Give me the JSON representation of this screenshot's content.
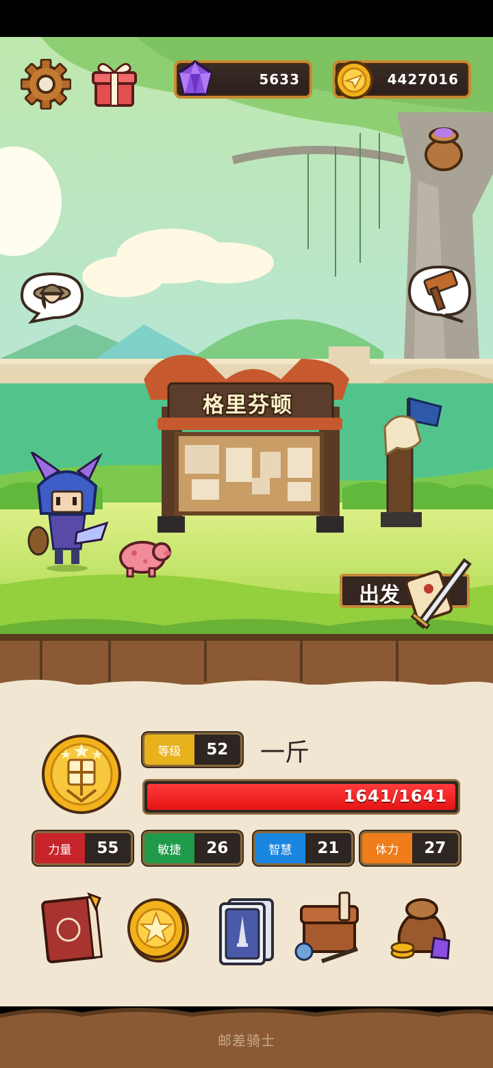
{
  "hud": {
    "gems": "5633",
    "coins": "4427016"
  },
  "scene": {
    "town_sign": "格里芬顿",
    "depart_label": "出发"
  },
  "player": {
    "level_label": "等级",
    "level": "52",
    "name": "一斤",
    "hp_text": "1641/1641",
    "hp_fraction": 1.0
  },
  "stats": [
    {
      "label": "力量",
      "value": "55",
      "color": "#c7232b"
    },
    {
      "label": "敏捷",
      "value": "26",
      "color": "#1e9a4a"
    },
    {
      "label": "智慧",
      "value": "21",
      "color": "#1a86e0"
    },
    {
      "label": "体力",
      "value": "27",
      "color": "#ee7d1a"
    }
  ],
  "menu": [
    {
      "icon": "hero-book-icon"
    },
    {
      "icon": "star-coin-icon"
    },
    {
      "icon": "card-deck-icon"
    },
    {
      "icon": "backpack-icon"
    },
    {
      "icon": "treasure-bag-icon"
    }
  ],
  "footer": {
    "title": "邮差骑士"
  }
}
